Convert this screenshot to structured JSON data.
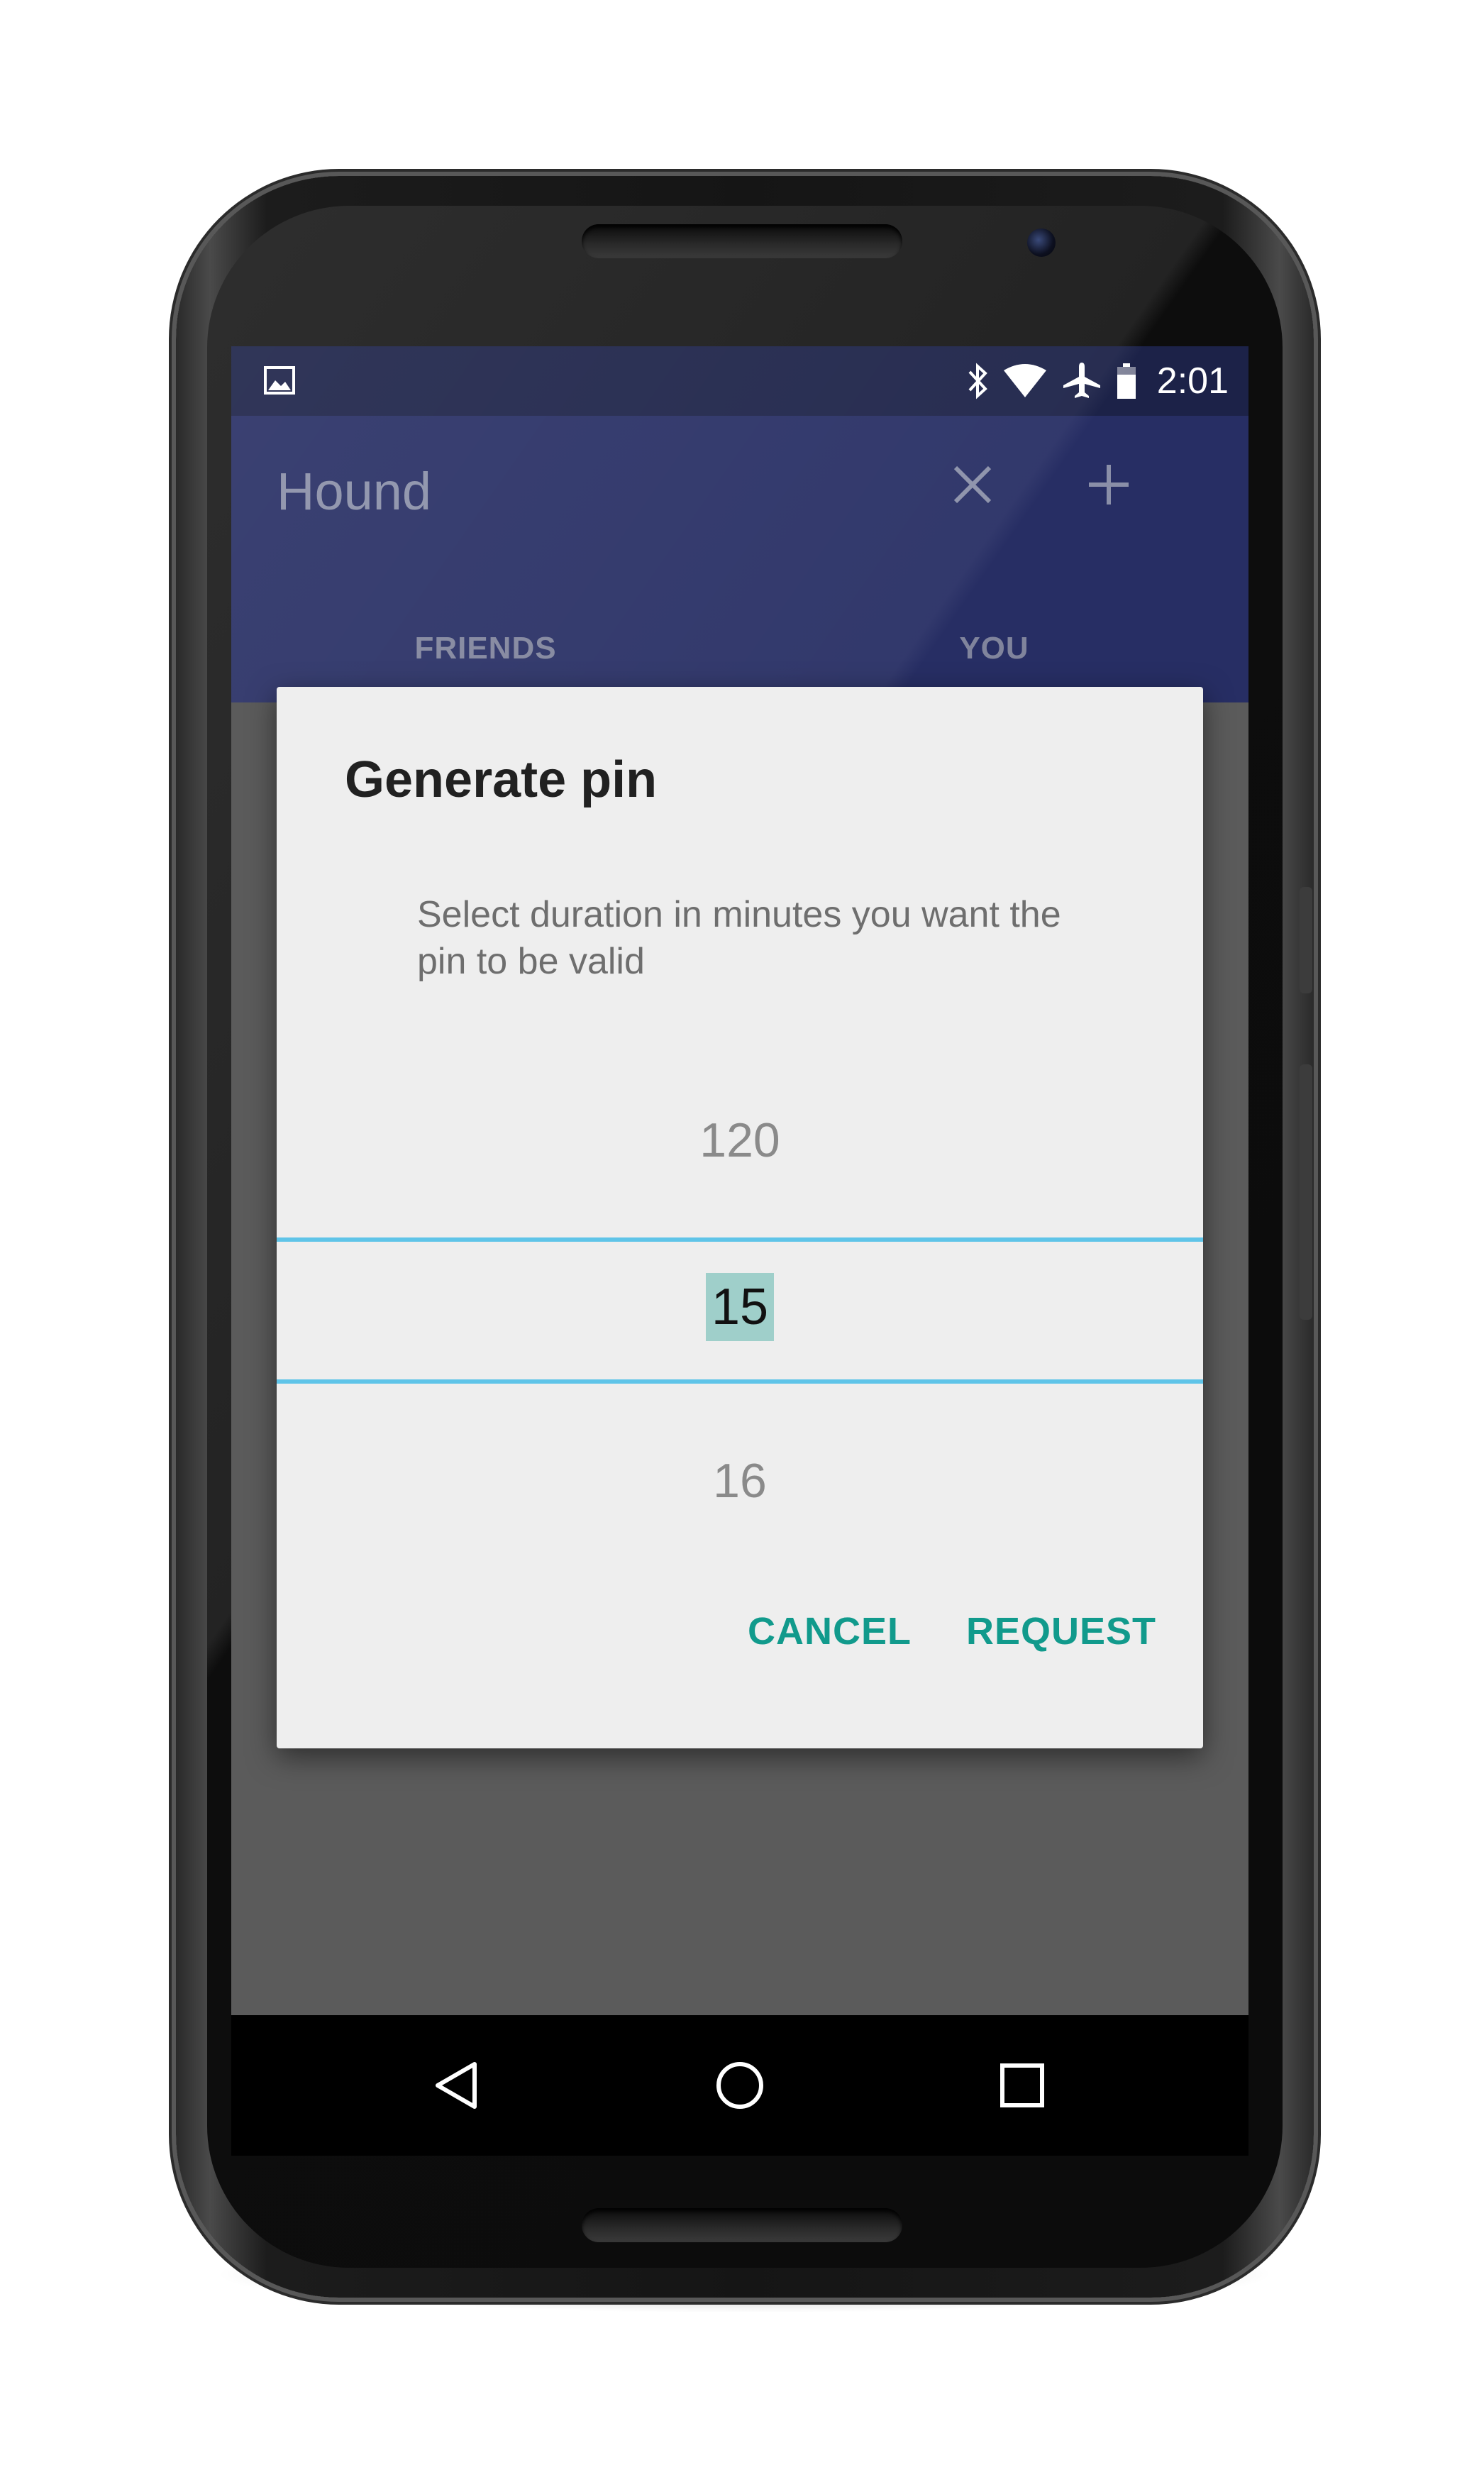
{
  "status_bar": {
    "time": "2:01",
    "left_icon": "image-notification-icon",
    "icons": [
      "bluetooth-icon",
      "wifi-icon",
      "airplane-icon",
      "battery-icon"
    ]
  },
  "app_bar": {
    "title": "Hound",
    "actions": [
      "close-icon",
      "add-icon"
    ]
  },
  "tabs": [
    {
      "label": "FRIENDS"
    },
    {
      "label": "YOU"
    }
  ],
  "dialog": {
    "title": "Generate pin",
    "message": "Select duration in minutes you want the pin to be valid",
    "picker": {
      "previous": "120",
      "selected": "15",
      "next": "16"
    },
    "buttons": {
      "cancel": "CANCEL",
      "request": "REQUEST"
    }
  },
  "nav_bar": {
    "buttons": [
      "back-icon",
      "home-icon",
      "recents-icon"
    ]
  },
  "colors": {
    "status_bar": "#1c2248",
    "app_bar": "#272e64",
    "accent": "#119a8c",
    "picker_divider": "#5fc4e8",
    "selection_highlight": "#9fcfca",
    "scrim": "#5b5b5b"
  }
}
